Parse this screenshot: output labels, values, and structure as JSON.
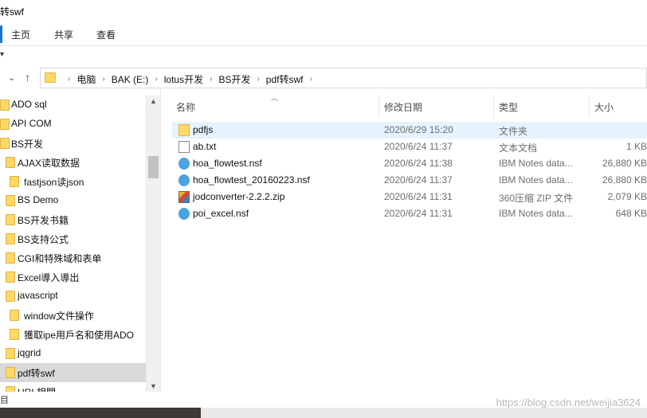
{
  "window": {
    "title": "转swf"
  },
  "ribbon": {
    "tabs": [
      "主页",
      "共享",
      "查看"
    ]
  },
  "address": {
    "back_icon": "chevron-down-icon",
    "up_arrow": "↑",
    "crumbs": [
      "电脑",
      "BAK (E:)",
      "lotus开发",
      "BS开发",
      "pdf转swf"
    ],
    "separator": "›"
  },
  "sidebar": {
    "items": [
      {
        "label": "ADO sql",
        "level": 0
      },
      {
        "label": "API COM",
        "level": 0
      },
      {
        "label": "BS开发",
        "level": 0
      },
      {
        "label": "AJAX读取数据",
        "level": 1
      },
      {
        "label": "fastjson读json",
        "level": 2
      },
      {
        "label": "BS Demo",
        "level": 1
      },
      {
        "label": "BS开发书籍",
        "level": 1
      },
      {
        "label": "BS支持公式",
        "level": 1
      },
      {
        "label": "CGI和特殊域和表单",
        "level": 1
      },
      {
        "label": "Excel導入導出",
        "level": 1
      },
      {
        "label": "javascript",
        "level": 1
      },
      {
        "label": "window文件操作",
        "level": 2
      },
      {
        "label": "獲取ipe用戶名和使用ADO",
        "level": 2
      },
      {
        "label": "jqgrid",
        "level": 1
      },
      {
        "label": "pdf转swf",
        "level": 1,
        "selected": true
      },
      {
        "label": "URL相關",
        "level": 1
      }
    ]
  },
  "list": {
    "columns": [
      "名称",
      "修改日期",
      "类型",
      "大小"
    ],
    "rows": [
      {
        "name": "pdfjs",
        "date": "2020/6/29 15:20",
        "type": "文件夹",
        "size": "",
        "icon": "folder-icon",
        "hover": true
      },
      {
        "name": "ab.txt",
        "date": "2020/6/24 11:37",
        "type": "文本文档",
        "size": "1 KB",
        "icon": "text-file-icon"
      },
      {
        "name": "hoa_flowtest.nsf",
        "date": "2020/6/24 11:38",
        "type": "IBM Notes data...",
        "size": "26,880 KB",
        "icon": "notes-db-icon"
      },
      {
        "name": "hoa_flowtest_20160223.nsf",
        "date": "2020/6/24 11:37",
        "type": "IBM Notes data...",
        "size": "26,880 KB",
        "icon": "notes-db-icon"
      },
      {
        "name": "jodconverter-2.2.2.zip",
        "date": "2020/6/24 11:31",
        "type": "360压缩 ZIP 文件",
        "size": "2,079 KB",
        "icon": "zip-archive-icon"
      },
      {
        "name": "poi_excel.nsf",
        "date": "2020/6/24 11:31",
        "type": "IBM Notes data...",
        "size": "648 KB",
        "icon": "notes-db-icon"
      }
    ]
  },
  "status": {
    "label": "目",
    "watermark": "https://blog.csdn.net/weijia3624"
  }
}
